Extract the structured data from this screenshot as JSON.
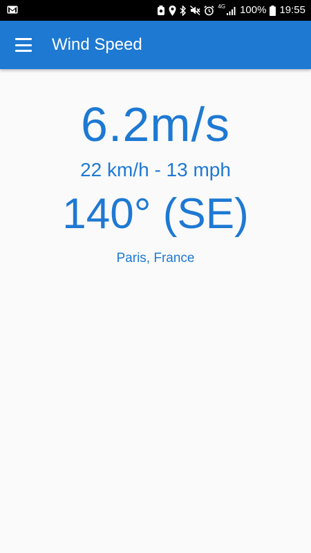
{
  "status_bar": {
    "battery_percent": "100%",
    "time": "19:55",
    "network_label": "4G",
    "icons": [
      "gmail-icon",
      "alarm-clock-icon",
      "location-icon",
      "bluetooth-icon",
      "mute-icon",
      "alarm-icon",
      "signal-icon",
      "battery-icon"
    ]
  },
  "app_bar": {
    "title": "Wind Speed",
    "menu_icon": "menu-icon",
    "color": "#1e79d3"
  },
  "reading": {
    "speed": "6.2m/s",
    "conversions": "22 km/h - 13 mph",
    "direction": "140° (SE)",
    "location": "Paris, France",
    "color": "#1e79d3"
  }
}
